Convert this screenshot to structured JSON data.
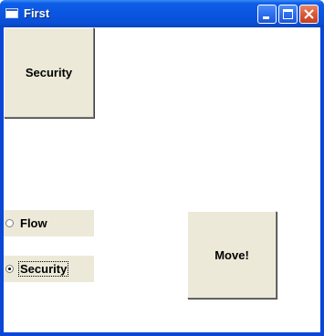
{
  "window": {
    "title": "First",
    "accent_color": "#0a55e0",
    "controls": {
      "minimize_icon": "minimize-icon",
      "maximize_icon": "maximize-icon",
      "close_icon": "close-icon"
    }
  },
  "content": {
    "security_button_label": "Security",
    "move_button_label": "Move!",
    "radios": [
      {
        "label": "Flow",
        "checked": false
      },
      {
        "label": "Security",
        "checked": true
      }
    ]
  }
}
